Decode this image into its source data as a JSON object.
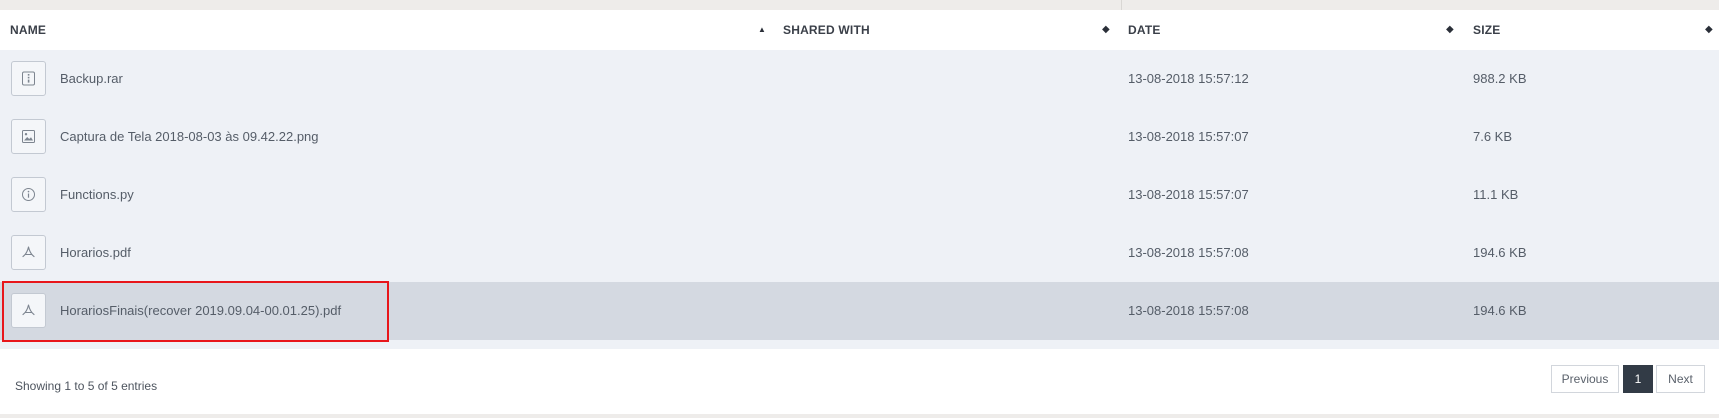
{
  "table": {
    "headers": {
      "name": "NAME",
      "shared_with": "SHARED WITH",
      "date": "DATE",
      "size": "SIZE"
    },
    "rows": [
      {
        "name": "Backup.rar",
        "shared_with": "",
        "date": "13-08-2018 15:57:12",
        "size": "988.2 KB",
        "icon": "archive-icon"
      },
      {
        "name": "Captura de Tela 2018-08-03 às 09.42.22.png",
        "shared_with": "",
        "date": "13-08-2018 15:57:07",
        "size": "7.6 KB",
        "icon": "image-icon"
      },
      {
        "name": "Functions.py",
        "shared_with": "",
        "date": "13-08-2018 15:57:07",
        "size": "11.1 KB",
        "icon": "info-icon"
      },
      {
        "name": "Horarios.pdf",
        "shared_with": "",
        "date": "13-08-2018 15:57:08",
        "size": "194.6 KB",
        "icon": "pdf-icon"
      },
      {
        "name": "HorariosFinais(recover 2019.09.04-00.01.25).pdf",
        "shared_with": "",
        "date": "13-08-2018 15:57:08",
        "size": "194.6 KB",
        "icon": "pdf-icon",
        "selected": true
      }
    ]
  },
  "footer": {
    "info": "Showing 1 to 5 of 5 entries",
    "pagination": {
      "previous": "Previous",
      "current_page": "1",
      "next": "Next"
    }
  },
  "colors": {
    "selected_row": "#d4d9e1",
    "row_background": "#eef1f6",
    "highlight_border": "#e8161b",
    "active_page": "#323b46"
  }
}
